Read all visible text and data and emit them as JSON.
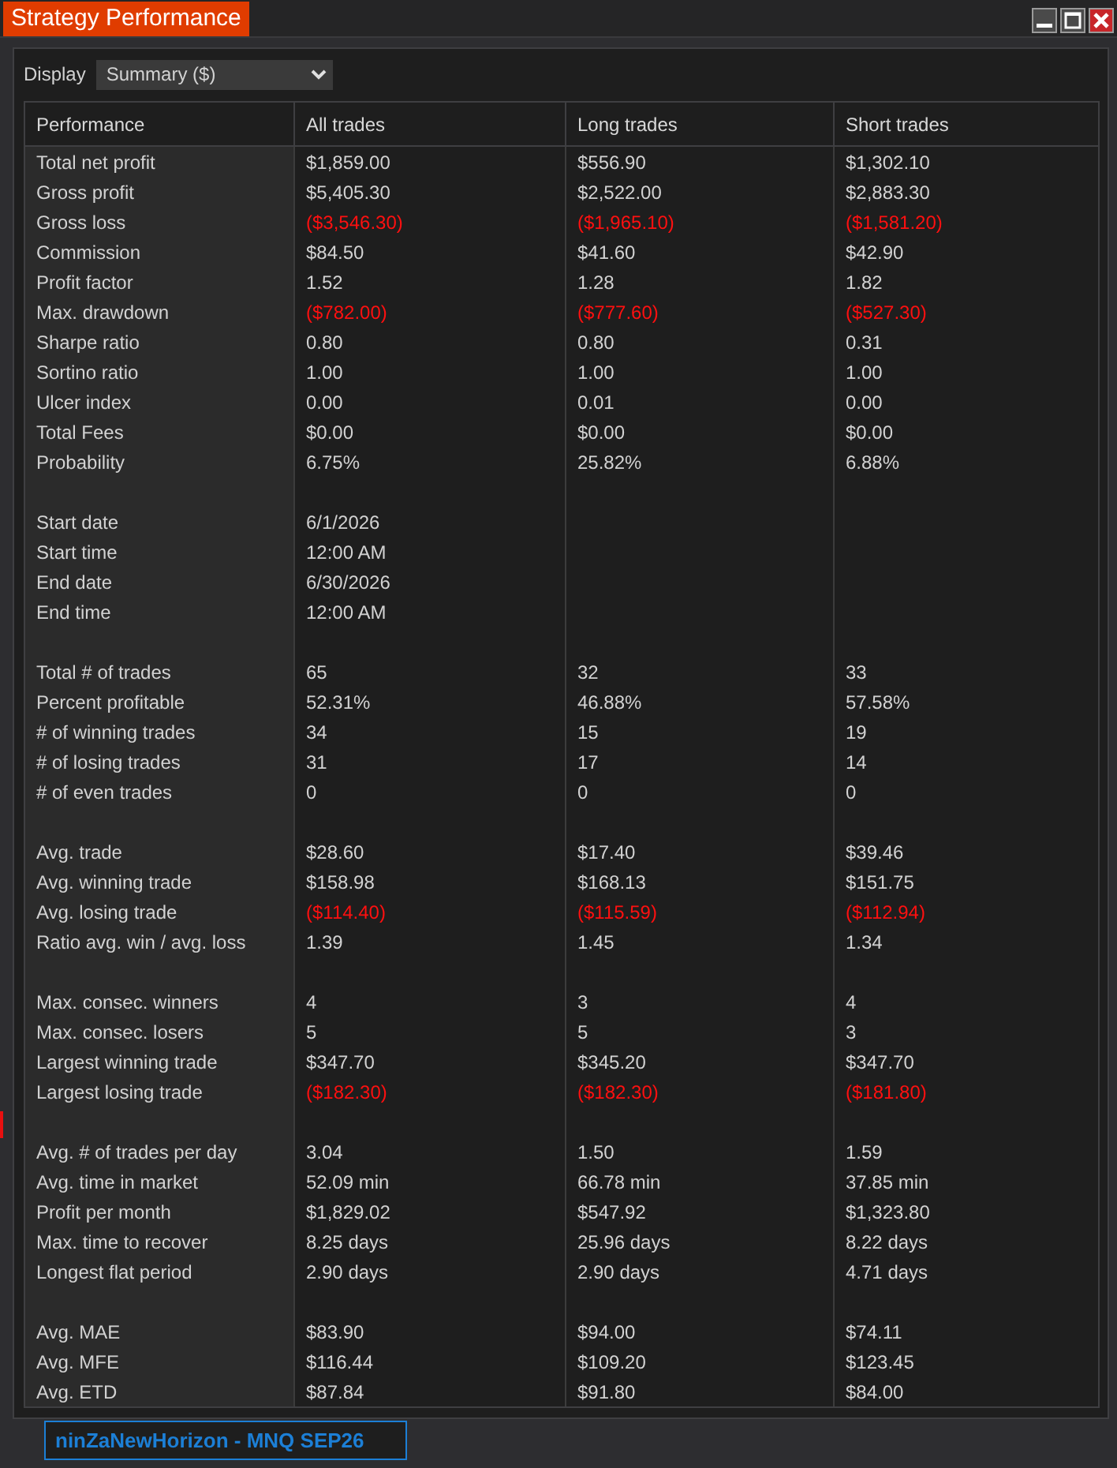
{
  "window": {
    "title": "Strategy Performance"
  },
  "display": {
    "label": "Display",
    "value": "Summary ($)"
  },
  "table": {
    "columns": [
      "Performance",
      "All trades",
      "Long trades",
      "Short trades"
    ],
    "sections": [
      {
        "rows": [
          {
            "label": "Total net profit",
            "values": [
              "$1,859.00",
              "$556.90",
              "$1,302.10"
            ],
            "negative": false
          },
          {
            "label": "Gross profit",
            "values": [
              "$5,405.30",
              "$2,522.00",
              "$2,883.30"
            ],
            "negative": false
          },
          {
            "label": "Gross loss",
            "values": [
              "($3,546.30)",
              "($1,965.10)",
              "($1,581.20)"
            ],
            "negative": true
          },
          {
            "label": "Commission",
            "values": [
              "$84.50",
              "$41.60",
              "$42.90"
            ],
            "negative": false
          },
          {
            "label": "Profit factor",
            "values": [
              "1.52",
              "1.28",
              "1.82"
            ],
            "negative": false
          },
          {
            "label": "Max. drawdown",
            "values": [
              "($782.00)",
              "($777.60)",
              "($527.30)"
            ],
            "negative": true
          },
          {
            "label": "Sharpe ratio",
            "values": [
              "0.80",
              "0.80",
              "0.31"
            ],
            "negative": false
          },
          {
            "label": "Sortino ratio",
            "values": [
              "1.00",
              "1.00",
              "1.00"
            ],
            "negative": false
          },
          {
            "label": "Ulcer index",
            "values": [
              "0.00",
              "0.01",
              "0.00"
            ],
            "negative": false
          },
          {
            "label": "Total Fees",
            "values": [
              "$0.00",
              "$0.00",
              "$0.00"
            ],
            "negative": false
          },
          {
            "label": "Probability",
            "values": [
              "6.75%",
              "25.82%",
              "6.88%"
            ],
            "negative": false
          }
        ]
      },
      {
        "rows": [
          {
            "label": "Start date",
            "values": [
              "6/1/2026"
            ],
            "negative": false
          },
          {
            "label": "Start time",
            "values": [
              "12:00 AM"
            ],
            "negative": false
          },
          {
            "label": "End date",
            "values": [
              "6/30/2026"
            ],
            "negative": false
          },
          {
            "label": "End time",
            "values": [
              "12:00 AM"
            ],
            "negative": false
          }
        ]
      },
      {
        "rows": [
          {
            "label": "Total # of trades",
            "values": [
              "65",
              "32",
              "33"
            ],
            "negative": false
          },
          {
            "label": "Percent profitable",
            "values": [
              "52.31%",
              "46.88%",
              "57.58%"
            ],
            "negative": false
          },
          {
            "label": "# of winning trades",
            "values": [
              "34",
              "15",
              "19"
            ],
            "negative": false
          },
          {
            "label": "# of losing trades",
            "values": [
              "31",
              "17",
              "14"
            ],
            "negative": false
          },
          {
            "label": "# of even trades",
            "values": [
              "0",
              "0",
              "0"
            ],
            "negative": false
          }
        ]
      },
      {
        "rows": [
          {
            "label": "Avg. trade",
            "values": [
              "$28.60",
              "$17.40",
              "$39.46"
            ],
            "negative": false
          },
          {
            "label": "Avg. winning trade",
            "values": [
              "$158.98",
              "$168.13",
              "$151.75"
            ],
            "negative": false
          },
          {
            "label": "Avg. losing trade",
            "values": [
              "($114.40)",
              "($115.59)",
              "($112.94)"
            ],
            "negative": true
          },
          {
            "label": "Ratio avg. win / avg. loss",
            "values": [
              "1.39",
              "1.45",
              "1.34"
            ],
            "negative": false
          }
        ]
      },
      {
        "rows": [
          {
            "label": "Max. consec. winners",
            "values": [
              "4",
              "3",
              "4"
            ],
            "negative": false
          },
          {
            "label": "Max. consec. losers",
            "values": [
              "5",
              "5",
              "3"
            ],
            "negative": false
          },
          {
            "label": "Largest winning trade",
            "values": [
              "$347.70",
              "$345.20",
              "$347.70"
            ],
            "negative": false
          },
          {
            "label": "Largest losing trade",
            "values": [
              "($182.30)",
              "($182.30)",
              "($181.80)"
            ],
            "negative": true
          }
        ]
      },
      {
        "rows": [
          {
            "label": "Avg. # of trades per day",
            "values": [
              "3.04",
              "1.50",
              "1.59"
            ],
            "negative": false
          },
          {
            "label": "Avg. time in market",
            "values": [
              "52.09 min",
              "66.78 min",
              "37.85 min"
            ],
            "negative": false
          },
          {
            "label": "Profit per month",
            "values": [
              "$1,829.02",
              "$547.92",
              "$1,323.80"
            ],
            "negative": false
          },
          {
            "label": "Max. time to recover",
            "values": [
              "8.25 days",
              "25.96 days",
              "8.22 days"
            ],
            "negative": false
          },
          {
            "label": "Longest flat period",
            "values": [
              "2.90 days",
              "2.90 days",
              "4.71 days"
            ],
            "negative": false
          }
        ]
      },
      {
        "rows": [
          {
            "label": "Avg. MAE",
            "values": [
              "$83.90",
              "$94.00",
              "$74.11"
            ],
            "negative": false
          },
          {
            "label": "Avg. MFE",
            "values": [
              "$116.44",
              "$109.20",
              "$123.45"
            ],
            "negative": false
          },
          {
            "label": "Avg. ETD",
            "values": [
              "$87.84",
              "$91.80",
              "$84.00"
            ],
            "negative": false
          }
        ]
      }
    ]
  },
  "footer_tab": {
    "label": "ninZaNewHorizon - MNQ SEP26",
    "selected": true
  }
}
